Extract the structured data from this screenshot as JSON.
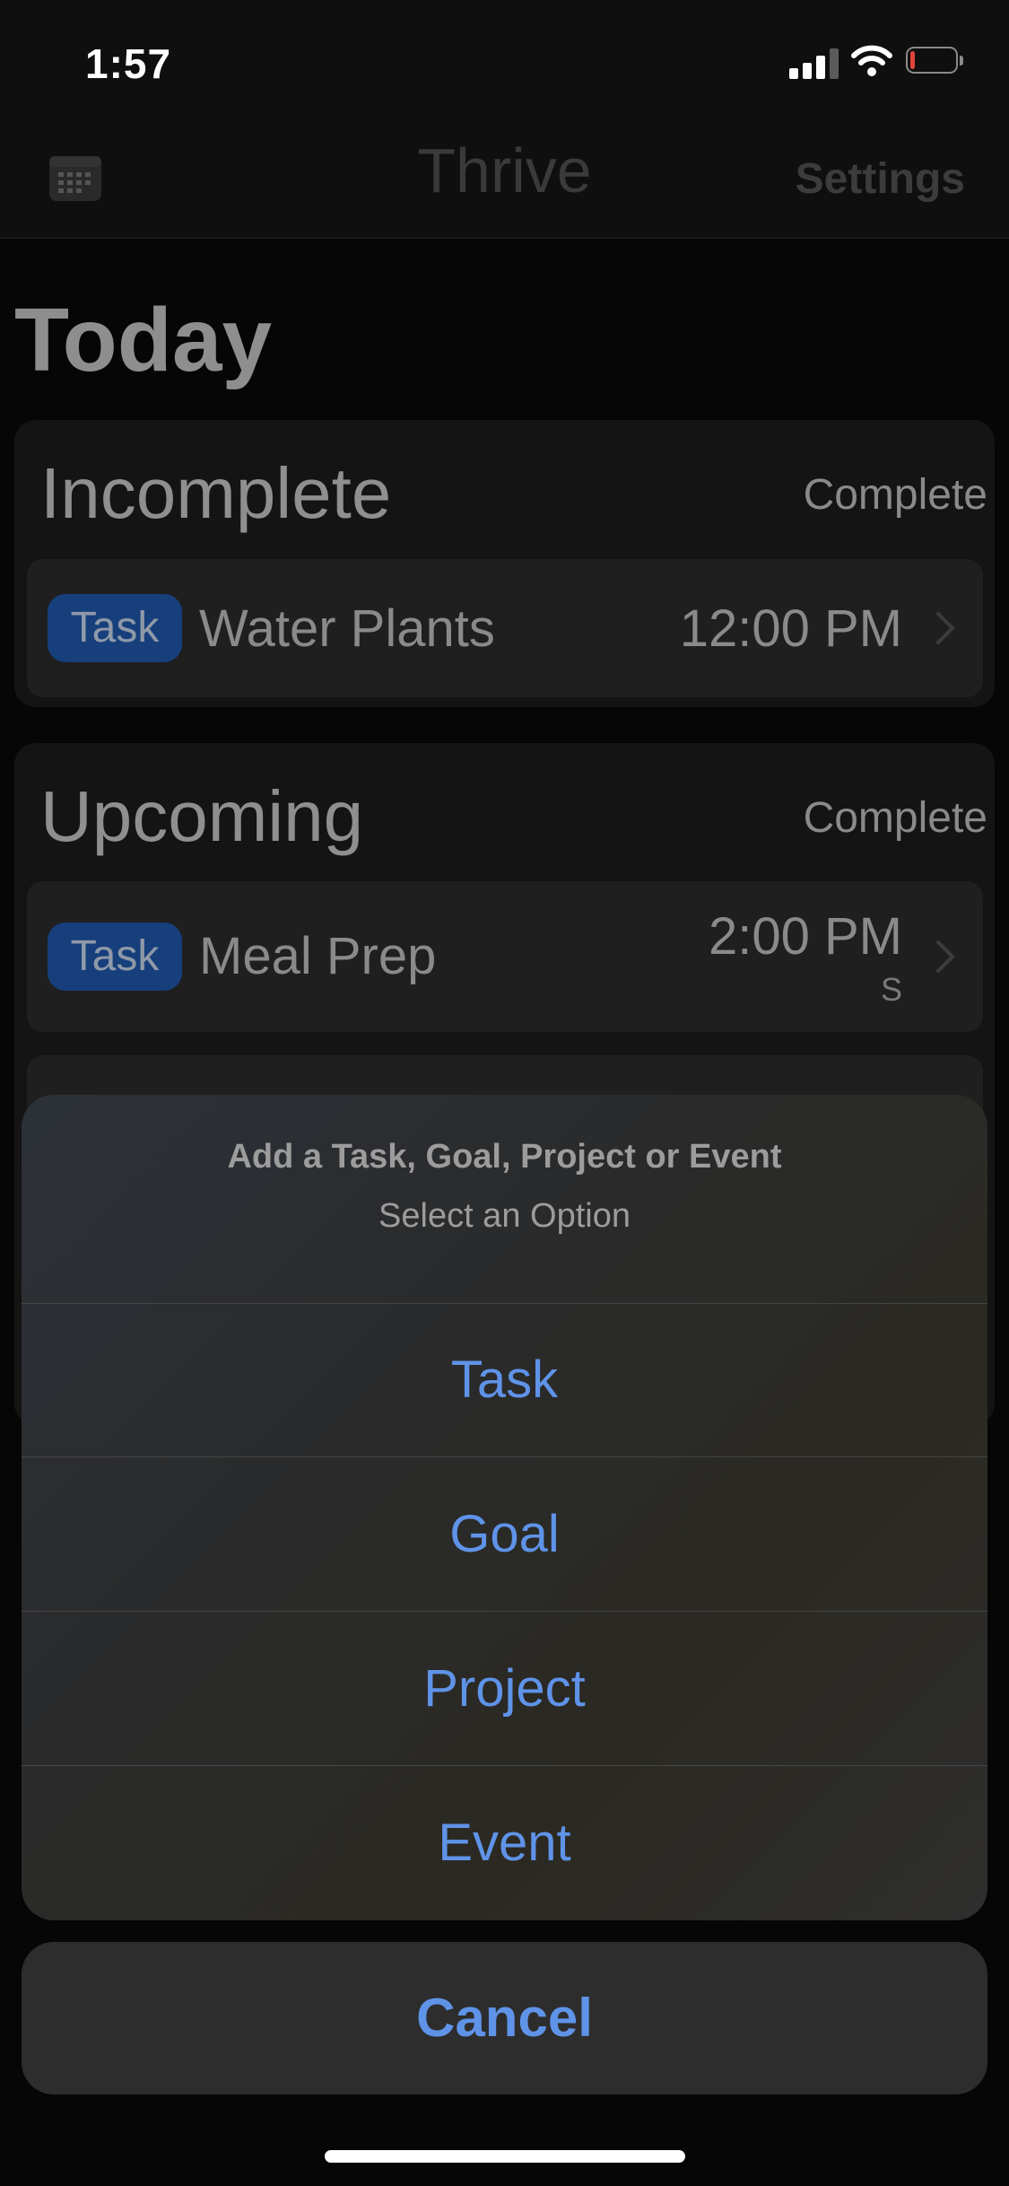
{
  "status_bar": {
    "time": "1:57",
    "icons": [
      "signal-icon",
      "wifi-icon",
      "battery-icon"
    ],
    "battery_level": 0.1
  },
  "nav": {
    "left_icon": "calendar-icon",
    "title": "Thrive",
    "settings_label": "Settings"
  },
  "page": {
    "title": "Today"
  },
  "sections": [
    {
      "title": "Incomplete",
      "action_label": "Complete",
      "items": [
        {
          "badge": "Task",
          "name": "Water Plants",
          "time": "12:00 PM",
          "sub": ""
        }
      ]
    },
    {
      "title": "Upcoming",
      "action_label": "Complete",
      "items": [
        {
          "badge": "Task",
          "name": "Meal Prep",
          "time": "2:00 PM",
          "sub": "S"
        }
      ]
    }
  ],
  "action_sheet": {
    "title": "Add a Task, Goal, Project or Event",
    "subtitle": "Select an Option",
    "options": [
      "Task",
      "Goal",
      "Project",
      "Event"
    ],
    "cancel_label": "Cancel"
  },
  "colors": {
    "accent": "#5f93e8",
    "badge": "#163f7c",
    "background": "#060606"
  }
}
